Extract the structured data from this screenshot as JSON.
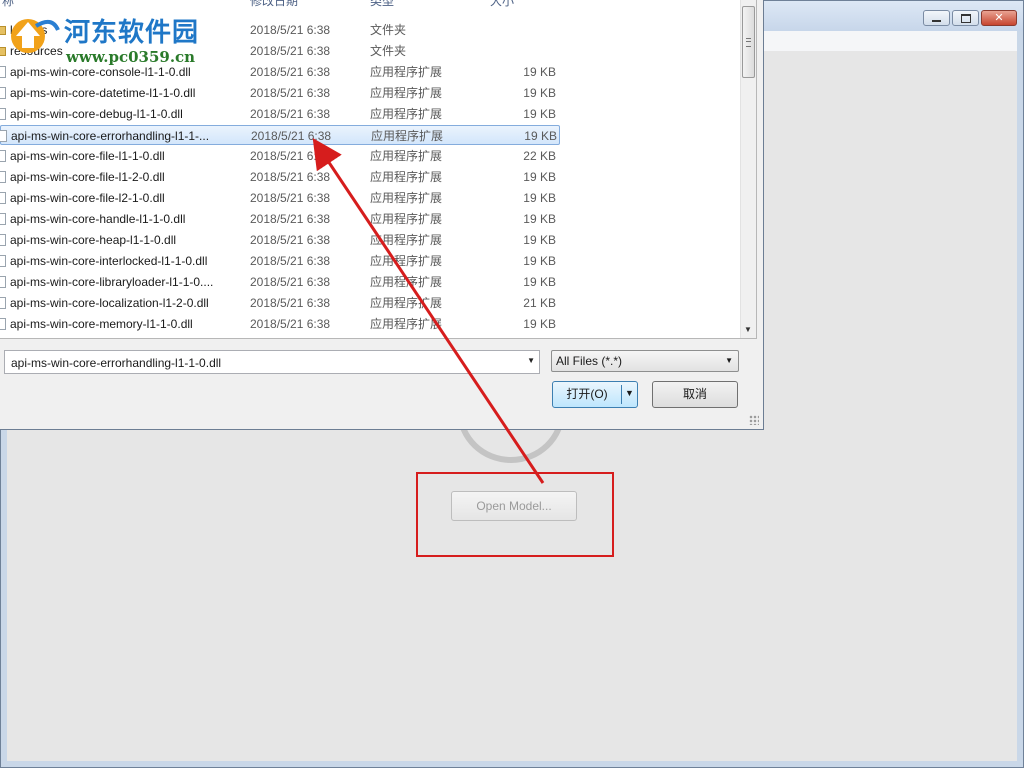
{
  "app": {
    "window_buttons": [
      "minimize",
      "maximize",
      "close"
    ],
    "open_model_label": "Open Model..."
  },
  "dialog": {
    "columns": {
      "name": "称",
      "date": "修改日期",
      "type": "类型",
      "size": "大小"
    },
    "rows": [
      {
        "name": "locales",
        "date": "2018/5/21 6:38",
        "type": "文件夹",
        "size": "",
        "icon": "folder-icon"
      },
      {
        "name": "resources",
        "date": "2018/5/21 6:38",
        "type": "文件夹",
        "size": "",
        "icon": "folder-icon"
      },
      {
        "name": "api-ms-win-core-console-l1-1-0.dll",
        "date": "2018/5/21 6:38",
        "type": "应用程序扩展",
        "size": "19 KB",
        "icon": "dll-file-icon"
      },
      {
        "name": "api-ms-win-core-datetime-l1-1-0.dll",
        "date": "2018/5/21 6:38",
        "type": "应用程序扩展",
        "size": "19 KB",
        "icon": "dll-file-icon"
      },
      {
        "name": "api-ms-win-core-debug-l1-1-0.dll",
        "date": "2018/5/21 6:38",
        "type": "应用程序扩展",
        "size": "19 KB",
        "icon": "dll-file-icon"
      },
      {
        "name": "api-ms-win-core-errorhandling-l1-1-...",
        "date": "2018/5/21 6:38",
        "type": "应用程序扩展",
        "size": "19 KB",
        "icon": "dll-file-icon",
        "selected": true
      },
      {
        "name": "api-ms-win-core-file-l1-1-0.dll",
        "date": "2018/5/21 6:38",
        "type": "应用程序扩展",
        "size": "22 KB",
        "icon": "dll-file-icon"
      },
      {
        "name": "api-ms-win-core-file-l1-2-0.dll",
        "date": "2018/5/21 6:38",
        "type": "应用程序扩展",
        "size": "19 KB",
        "icon": "dll-file-icon"
      },
      {
        "name": "api-ms-win-core-file-l2-1-0.dll",
        "date": "2018/5/21 6:38",
        "type": "应用程序扩展",
        "size": "19 KB",
        "icon": "dll-file-icon"
      },
      {
        "name": "api-ms-win-core-handle-l1-1-0.dll",
        "date": "2018/5/21 6:38",
        "type": "应用程序扩展",
        "size": "19 KB",
        "icon": "dll-file-icon"
      },
      {
        "name": "api-ms-win-core-heap-l1-1-0.dll",
        "date": "2018/5/21 6:38",
        "type": "应用程序扩展",
        "size": "19 KB",
        "icon": "dll-file-icon"
      },
      {
        "name": "api-ms-win-core-interlocked-l1-1-0.dll",
        "date": "2018/5/21 6:38",
        "type": "应用程序扩展",
        "size": "19 KB",
        "icon": "dll-file-icon"
      },
      {
        "name": "api-ms-win-core-libraryloader-l1-1-0....",
        "date": "2018/5/21 6:38",
        "type": "应用程序扩展",
        "size": "19 KB",
        "icon": "dll-file-icon"
      },
      {
        "name": "api-ms-win-core-localization-l1-2-0.dll",
        "date": "2018/5/21 6:38",
        "type": "应用程序扩展",
        "size": "21 KB",
        "icon": "dll-file-icon"
      },
      {
        "name": "api-ms-win-core-memory-l1-1-0.dll",
        "date": "2018/5/21 6:38",
        "type": "应用程序扩展",
        "size": "19 KB",
        "icon": "dll-file-icon"
      }
    ],
    "filename_value": "api-ms-win-core-errorhandling-l1-1-0.dll",
    "filter_value": "All Files (*.*)",
    "open_label": "打开(O)",
    "cancel_label": "取消"
  },
  "watermark": {
    "title": "河东软件园",
    "url": "www.pc0359.cn"
  },
  "annotation_colors": {
    "highlight": "#d61d1d",
    "arrow": "#d61d1d"
  }
}
